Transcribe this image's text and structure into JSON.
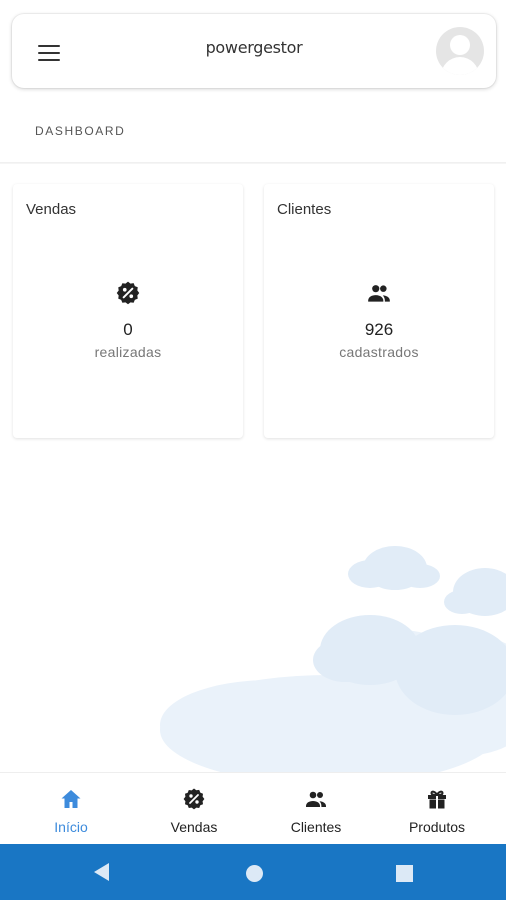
{
  "app": {
    "brand": "powergestor"
  },
  "section": {
    "title": "DASHBOARD"
  },
  "cards": [
    {
      "title": "Vendas",
      "count": "0",
      "label": "realizadas",
      "icon": "discount-badge-icon"
    },
    {
      "title": "Clientes",
      "count": "926",
      "label": "cadastrados",
      "icon": "people-icon"
    }
  ],
  "nav": {
    "items": [
      {
        "label": "Início",
        "icon": "home-icon",
        "active": true
      },
      {
        "label": "Vendas",
        "icon": "discount-badge-icon",
        "active": false
      },
      {
        "label": "Clientes",
        "icon": "people-icon",
        "active": false
      },
      {
        "label": "Produtos",
        "icon": "gift-icon",
        "active": false
      }
    ]
  },
  "colors": {
    "accent": "#3d8bdc",
    "system_bar": "#1976c4",
    "cloud": "#e3eef8"
  }
}
